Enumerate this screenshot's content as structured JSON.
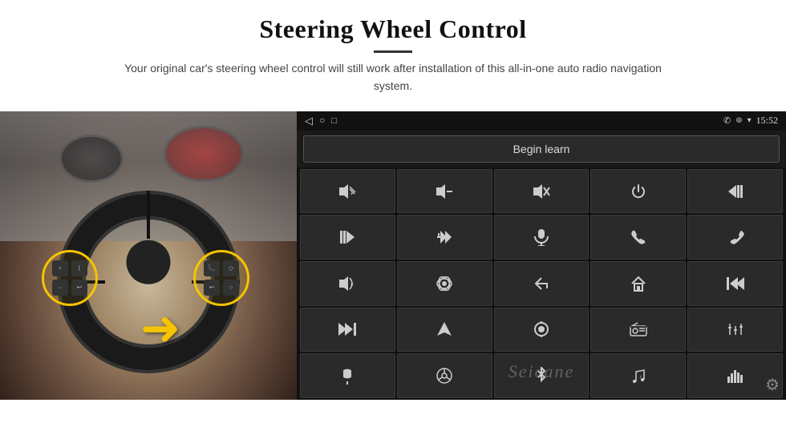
{
  "header": {
    "title": "Steering Wheel Control",
    "subtitle": "Your original car's steering wheel control will still work after installation of this all-in-one auto radio navigation system."
  },
  "status_bar": {
    "left_icons": [
      "◁",
      "○",
      "□"
    ],
    "battery_icon": "▪▪",
    "right_icons": [
      "✆",
      "⊛",
      "▾"
    ],
    "time": "15:52"
  },
  "begin_learn": {
    "label": "Begin learn"
  },
  "controls": [
    {
      "icon": "🔊+",
      "label": "vol-up"
    },
    {
      "icon": "🔊−",
      "label": "vol-down"
    },
    {
      "icon": "🔇",
      "label": "mute"
    },
    {
      "icon": "⏻",
      "label": "power"
    },
    {
      "icon": "⏮",
      "label": "prev-track"
    },
    {
      "icon": "⏭",
      "label": "next"
    },
    {
      "icon": "✂⏭",
      "label": "ff"
    },
    {
      "icon": "🎤",
      "label": "mic"
    },
    {
      "icon": "📞",
      "label": "call"
    },
    {
      "icon": "↩",
      "label": "hang-up"
    },
    {
      "icon": "📢",
      "label": "speaker"
    },
    {
      "icon": "⊛",
      "label": "360"
    },
    {
      "icon": "↩",
      "label": "back"
    },
    {
      "icon": "⌂",
      "label": "home"
    },
    {
      "icon": "⏮⏮",
      "label": "rewind"
    },
    {
      "icon": "⏭⏭",
      "label": "fast-forward"
    },
    {
      "icon": "▲",
      "label": "nav"
    },
    {
      "icon": "⏺",
      "label": "source"
    },
    {
      "icon": "📻",
      "label": "radio"
    },
    {
      "icon": "⚙",
      "label": "eq"
    },
    {
      "icon": "✏",
      "label": "mic2"
    },
    {
      "icon": "⊙",
      "label": "wheel"
    },
    {
      "icon": "✱",
      "label": "bt"
    },
    {
      "icon": "♪",
      "label": "music"
    },
    {
      "icon": "📊",
      "label": "spectrum"
    }
  ],
  "watermark": "Seicane",
  "yellow_arrow": "➜"
}
